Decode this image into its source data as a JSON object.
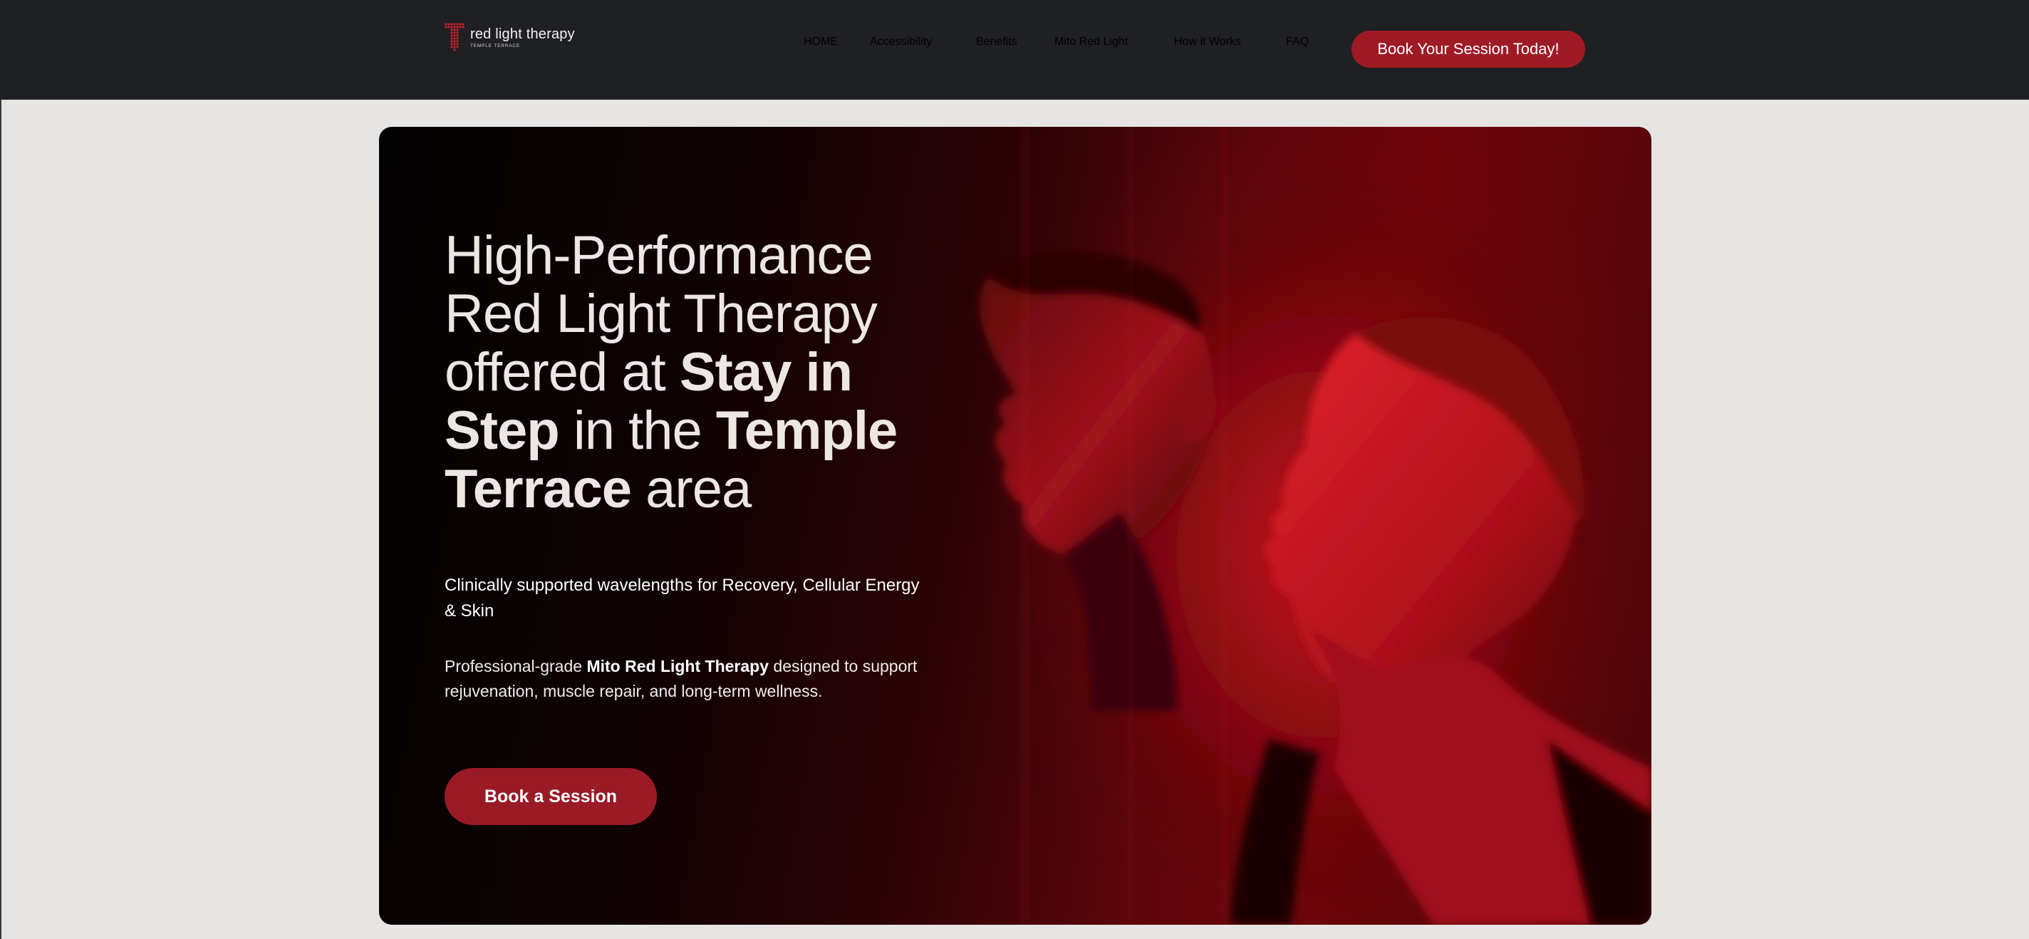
{
  "brand": {
    "name": "red light therapy",
    "location": "TEMPLE TERRACE"
  },
  "nav": {
    "items": [
      "HOME",
      "Accessibility",
      "Benefits",
      "Mito Red Light",
      "How it Works",
      "FAQ"
    ],
    "cta_label": "Book Your Session Today!"
  },
  "hero": {
    "headline": {
      "part1": "High-Performance Red Light Therapy offered at ",
      "bold1": "Stay in Step",
      "part2": " in the ",
      "bold2": "Temple Terrace",
      "part3": " area"
    },
    "subheading": "Clinically supported wavelengths for Recovery, Cellular Energy & Skin",
    "body": {
      "prefix": "Professional-grade ",
      "bold": "Mito Red Light Therapy",
      "suffix": " designed to support rejuvenation, muscle repair, and long-term wellness."
    },
    "cta_label": "Book a Session"
  },
  "colors": {
    "header_bg": "#1f2023",
    "page_bg": "#e6e5e3",
    "accent": "#9e1b26"
  },
  "icons": {
    "logo": "red-dot-grid-T-logo"
  }
}
